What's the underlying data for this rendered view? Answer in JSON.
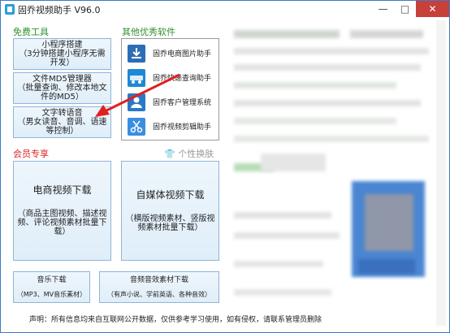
{
  "window": {
    "title": "固乔视频助手  V96.0",
    "min_label": "—",
    "max_label": "□",
    "close_label": "✕"
  },
  "free_tools": {
    "title": "免费工具",
    "buttons": [
      {
        "label": "小程序搭建\n（3分钟搭建小程序无需开发）"
      },
      {
        "label": "文件MD5管理器\n（批量查询、修改本地文件的MD5）"
      },
      {
        "label": "文字转语音\n（男女读音、音调、语速等控制）"
      }
    ]
  },
  "other_software": {
    "title": "其他优秀软件",
    "items": [
      {
        "label": "固乔电商图片助手",
        "icon": "download-icon"
      },
      {
        "label": "固乔快递查询助手",
        "icon": "express-icon"
      },
      {
        "label": "固乔客户管理系统",
        "icon": "crm-icon"
      },
      {
        "label": "固乔视频剪辑助手",
        "icon": "scissors-icon"
      }
    ]
  },
  "member": {
    "title": "会员专享",
    "skin_label": "个性换肤",
    "ecommerce": {
      "title": "电商视频下载",
      "subtitle": "（商品主图视频、描述视频、评论视频素材批量下载）"
    },
    "media": {
      "title": "自媒体视频下载",
      "subtitle": "（横版视频素材、竖版视频素材批量下载）"
    },
    "music": {
      "title": "音乐下载",
      "subtitle": "（MP3、MV音乐素材）"
    },
    "audio": {
      "title": "音频音效素材下载",
      "subtitle": "（有声小说、学前英语、各种音效）"
    }
  },
  "footer": {
    "text": "声明：所有信息均来自互联网公开数据，仅供参考学习使用，如有侵权，请联系管理员删除"
  },
  "colors": {
    "accent_blue": "#3b7ac9",
    "green_heading": "#2f8f2f",
    "red_heading": "#dd2222",
    "close_red": "#c7403a"
  }
}
